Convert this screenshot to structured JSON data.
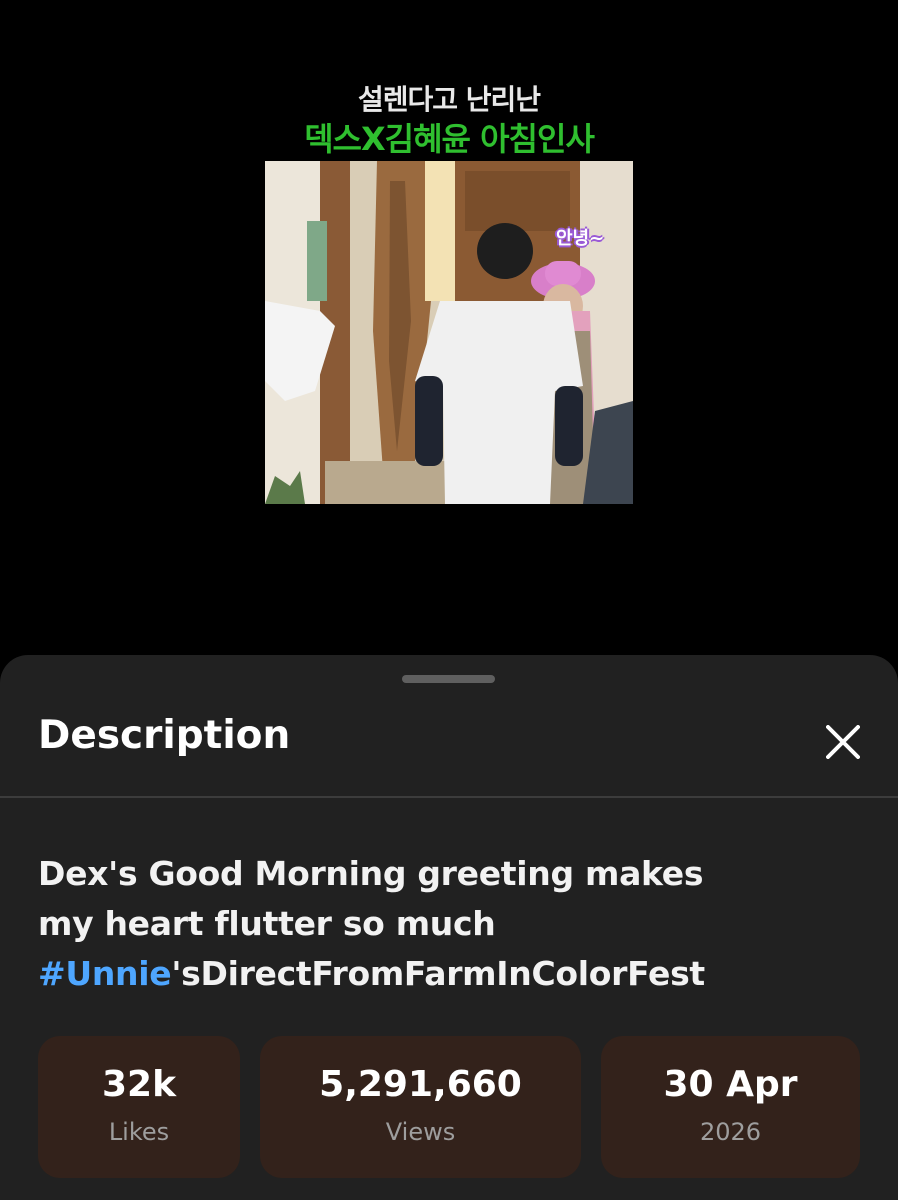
{
  "video": {
    "overlay_line1": "설렌다고 난리난",
    "overlay_line2": "덱스X김혜윤 아침인사",
    "speech_bubble": "안녕~"
  },
  "sheet": {
    "title": "Description",
    "close_icon": "close-icon"
  },
  "description": {
    "text_before": "Dex's Good Morning greeting makes my heart flutter so much ",
    "hashtag": "#Unnie",
    "text_after": "'sDirectFromFarmInColorFest"
  },
  "stats": {
    "likes": {
      "value": "32k",
      "label": "Likes"
    },
    "views": {
      "value": "5,291,660",
      "label": "Views"
    },
    "date": {
      "value": "30 Apr",
      "label": "2026"
    }
  },
  "colors": {
    "background": "#000000",
    "sheet_bg": "#212121",
    "stat_bg": "#33221b",
    "hashtag": "#4ea6ff",
    "overlay_green": "#2fbf2f"
  }
}
